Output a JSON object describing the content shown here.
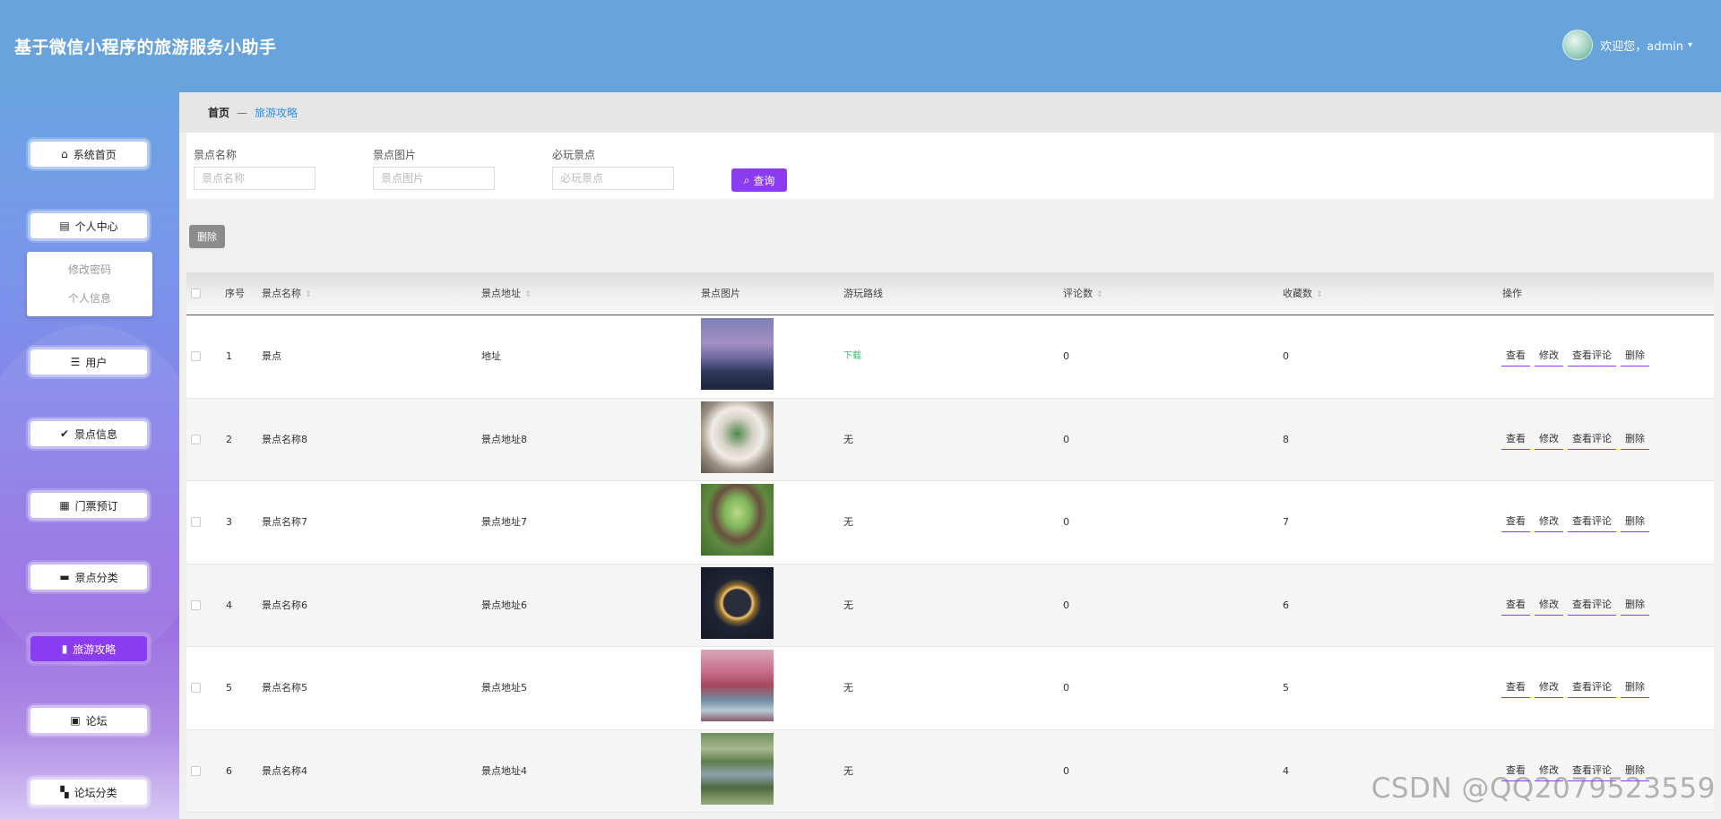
{
  "app": {
    "title": "基于微信小程序的旅游服务小助手"
  },
  "user": {
    "greeting": "欢迎您，admin"
  },
  "sidebar": {
    "items": [
      {
        "label": "系统首页",
        "icon": "⌂",
        "icon_name": "home-icon"
      },
      {
        "label": "个人中心",
        "icon": "▤",
        "icon_name": "profile-icon"
      },
      {
        "label": "用户",
        "icon": "☰",
        "icon_name": "users-icon"
      },
      {
        "label": "景点信息",
        "icon": "✔",
        "icon_name": "checklist-icon"
      },
      {
        "label": "门票预订",
        "icon": "▦",
        "icon_name": "grid-icon"
      },
      {
        "label": "景点分类",
        "icon": "▬",
        "icon_name": "monitor-icon"
      },
      {
        "label": "旅游攻略",
        "icon": "▮",
        "icon_name": "bar-chart-icon"
      },
      {
        "label": "论坛",
        "icon": "▣",
        "icon_name": "clipboard-icon"
      },
      {
        "label": "论坛分类",
        "icon": "▚",
        "icon_name": "apps-icon"
      }
    ],
    "sub_items": [
      {
        "label": "修改密码"
      },
      {
        "label": "个人信息"
      }
    ],
    "active_label": "旅游攻略"
  },
  "breadcrumb": {
    "home": "首页",
    "separator": "—",
    "current": "旅游攻略"
  },
  "search": {
    "fields": [
      {
        "label": "景点名称",
        "placeholder": "景点名称"
      },
      {
        "label": "景点图片",
        "placeholder": "景点图片"
      },
      {
        "label": "必玩景点",
        "placeholder": "必玩景点"
      }
    ],
    "query_label": "查询"
  },
  "toolbar": {
    "delete_label": "删除"
  },
  "table": {
    "columns": [
      "序号",
      "景点名称",
      "景点地址",
      "景点图片",
      "游玩路线",
      "评论数",
      "收藏数",
      "操作"
    ],
    "rows": [
      {
        "index": "1",
        "name": "景点",
        "address": "地址",
        "route": "下载",
        "comments": "0",
        "favorites": "0"
      },
      {
        "index": "2",
        "name": "景点名称8",
        "address": "景点地址8",
        "route": "无",
        "comments": "0",
        "favorites": "8"
      },
      {
        "index": "3",
        "name": "景点名称7",
        "address": "景点地址7",
        "route": "无",
        "comments": "0",
        "favorites": "7"
      },
      {
        "index": "4",
        "name": "景点名称6",
        "address": "景点地址6",
        "route": "无",
        "comments": "0",
        "favorites": "6"
      },
      {
        "index": "5",
        "name": "景点名称5",
        "address": "景点地址5",
        "route": "无",
        "comments": "0",
        "favorites": "5"
      },
      {
        "index": "6",
        "name": "景点名称4",
        "address": "景点地址4",
        "route": "无",
        "comments": "0",
        "favorites": "4"
      }
    ],
    "actions": [
      "查看",
      "修改",
      "查看评论",
      "删除"
    ]
  },
  "watermark": "CSDN @QQ2079523559",
  "colors": {
    "header": "#68a3db",
    "accent": "#8b3bf0",
    "link": "#3a8ee6",
    "route_download": "#2bc06b"
  }
}
